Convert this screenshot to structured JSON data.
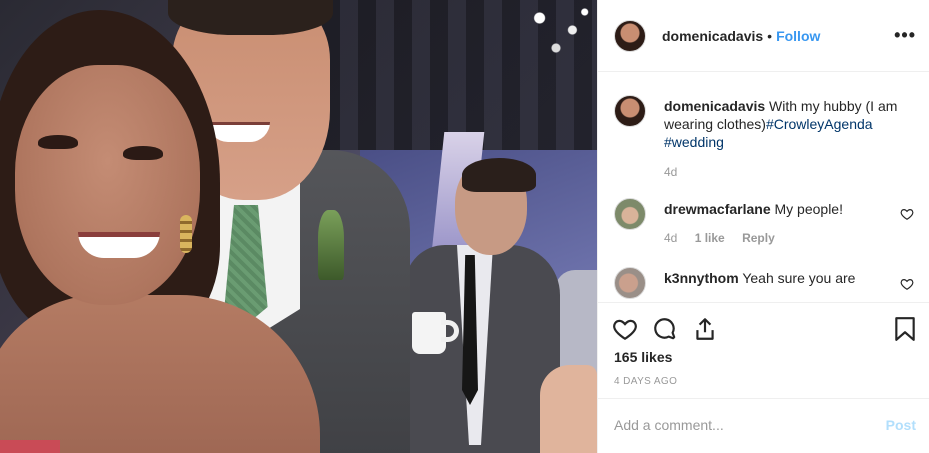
{
  "post": {
    "username": "domenicadavis",
    "separator": "•",
    "follow_label": "Follow",
    "more_icon": "more-horizontal-icon"
  },
  "caption": {
    "username": "domenicadavis",
    "text": "With my hubby (I am wearing clothes)",
    "hashtag1": "#CrowleyAgenda",
    "hashtag2": "#wedding",
    "age": "4d"
  },
  "comments": [
    {
      "username": "drewmacfarlane",
      "text": "My people!",
      "age": "4d",
      "likes": "1 like",
      "reply_label": "Reply"
    },
    {
      "username": "k3nnythom",
      "text": "Yeah sure you are"
    }
  ],
  "footer": {
    "likes": "165 likes",
    "posted": "4 DAYS AGO",
    "comment_placeholder": "Add a comment...",
    "post_label": "Post"
  },
  "colors": {
    "accent": "#3897f0",
    "hashtag": "#003569",
    "muted": "#999999",
    "post_disabled": "#b2dffc"
  }
}
